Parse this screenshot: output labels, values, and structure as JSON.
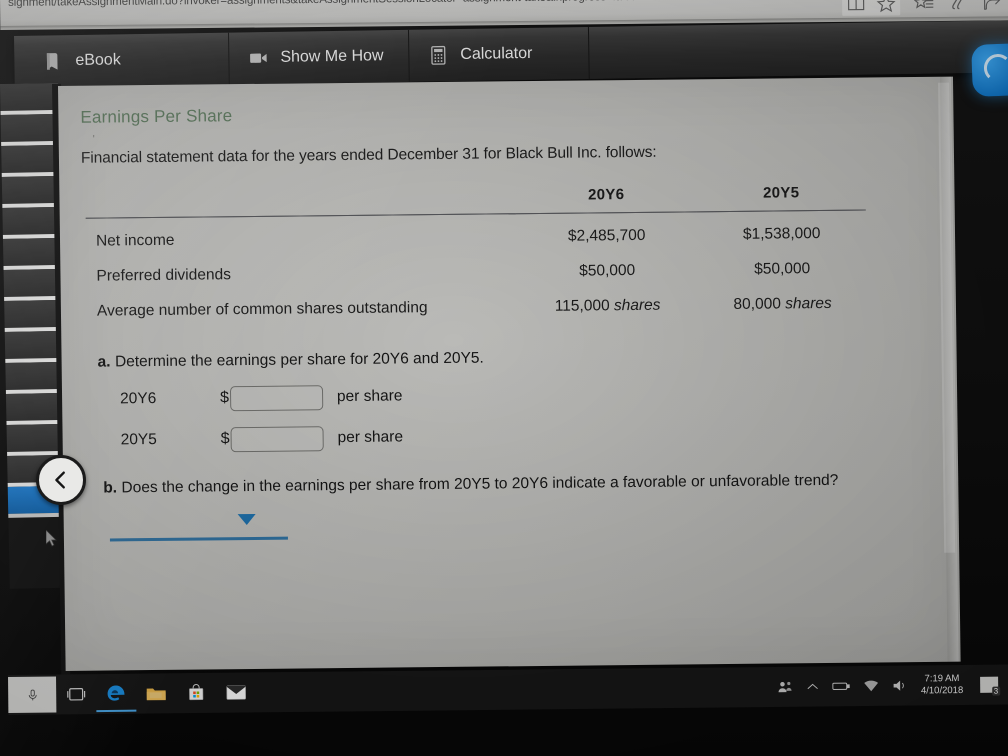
{
  "browser": {
    "url": "signment/takeAssignmentMain.do?invoker=assignments&takeAssignmentSessionLocator=assignment-take&inprogress=false",
    "icons": [
      {
        "name": "reading-view-icon",
        "glyph": "reading-view"
      },
      {
        "name": "favorite-star-icon",
        "glyph": "star"
      },
      {
        "name": "hub-favorites-icon",
        "glyph": "star-list"
      },
      {
        "name": "web-note-icon",
        "glyph": "pen"
      },
      {
        "name": "share-icon",
        "glyph": "share"
      }
    ]
  },
  "toolbar": {
    "tabs": [
      {
        "label": "eBook",
        "icon": "book-icon"
      },
      {
        "label": "Show Me How",
        "icon": "video-camera-icon"
      },
      {
        "label": "Calculator",
        "icon": "calculator-icon"
      }
    ],
    "help_widget": "help-bubble"
  },
  "navigator": {
    "collapse_label": "<",
    "rows": 14,
    "selected_index": 13
  },
  "content": {
    "title": "Earnings Per Share",
    "tick_mark": "'",
    "intro": "Financial statement data for the years ended December 31 for Black Bull Inc. follows:",
    "table": {
      "col_headers": [
        "20Y6",
        "20Y5"
      ],
      "rows": [
        {
          "label": "Net income",
          "y6": "$2,485,700",
          "y5": "$1,538,000",
          "y6_units": "",
          "y5_units": ""
        },
        {
          "label": "Preferred dividends",
          "y6": "$50,000",
          "y5": "$50,000",
          "y6_units": "",
          "y5_units": ""
        },
        {
          "label": "Average number of common shares outstanding",
          "y6": "115,000",
          "y5": "80,000",
          "y6_units": "shares",
          "y5_units": "shares"
        }
      ]
    },
    "part_a": {
      "marker": "a.",
      "question": "Determine the earnings per share for 20Y6 and 20Y5.",
      "answers": [
        {
          "year": "20Y6",
          "dollar": "$",
          "value": "",
          "placeholder": "",
          "suffix": "per share"
        },
        {
          "year": "20Y5",
          "dollar": "$",
          "value": "",
          "placeholder": "",
          "suffix": "per share"
        }
      ]
    },
    "part_b": {
      "marker": "b.",
      "question": "Does the change in the earnings per share from 20Y5 to 20Y6 indicate a favorable or unfavorable trend?",
      "dropdown_value": "",
      "dropdown_icon": "caret-down-icon"
    },
    "accent_color": "#2f6f9e",
    "title_color": "#5d7a5f"
  },
  "taskbar": {
    "cortana_icon": "microphone-icon",
    "items": [
      {
        "name": "task-view-icon",
        "label": "Task View"
      },
      {
        "name": "edge-browser-icon",
        "label": "Microsoft Edge"
      },
      {
        "name": "file-explorer-icon",
        "label": "File Explorer"
      },
      {
        "name": "microsoft-store-icon",
        "label": "Microsoft Store"
      },
      {
        "name": "mail-icon",
        "label": "Mail"
      }
    ],
    "tray": [
      "people-icon",
      "show-hidden-icons-chevron",
      "battery-icon",
      "wifi-icon",
      "volume-icon"
    ],
    "clock_time": "7:19 AM",
    "clock_date": "4/10/2018",
    "notification_badge": "3"
  }
}
